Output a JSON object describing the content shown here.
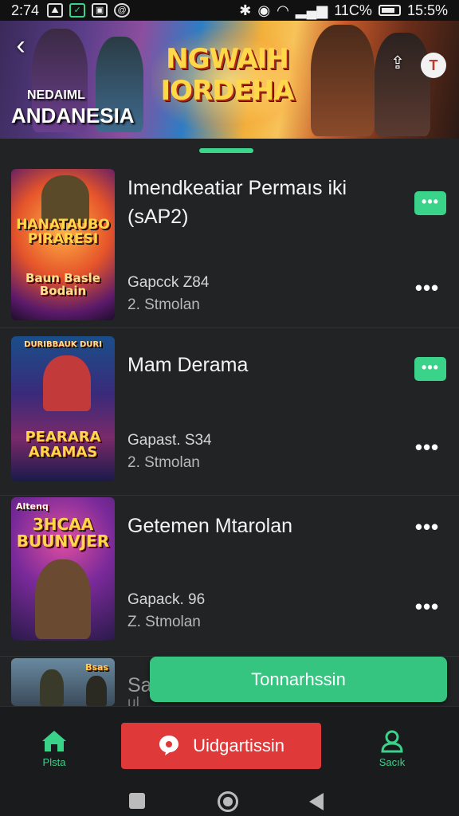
{
  "status_bar": {
    "time": "2:74",
    "battery": "11C%",
    "clock": "15:5%"
  },
  "banner": {
    "back_icon": "back-arrow-icon",
    "subtitle_line1": "NEDAIML",
    "subtitle_line2": "ANDANESIA",
    "title": "NGWAIH IORDEHA",
    "share_icon": "share-icon",
    "profile_letter": "T"
  },
  "items": [
    {
      "thumb_text": "HANATAUBO PIRARESI",
      "thumb_text2": "Baun Basle Bodain",
      "title": "Imendkeatiar Permaıs iki (sAP2)",
      "meta1": "Gapcck Z84",
      "meta2": "2. Stmolan",
      "has_tag": true,
      "tag_label": "•••",
      "more_label": "•••"
    },
    {
      "thumb_text": "PEARARA ARAMAS",
      "thumb_text2": "DURIBBAUK DURI",
      "title": "Mam Derama",
      "meta1": "Gapast. S34",
      "meta2": "2. Stmolan",
      "has_tag": true,
      "tag_label": "•••",
      "more_label": "•••"
    },
    {
      "thumb_text": "3HCAA BUUNVJER",
      "thumb_text2": "Altenq",
      "title": "Getemen Mtarolan",
      "meta1": "Gapack. 96",
      "meta2": "Z. Stmolan",
      "has_tag": false,
      "more_label": "•••",
      "more_label2": "•••"
    },
    {
      "thumb_text": "Bsas",
      "title": "Sa",
      "meta1": "ul",
      "has_tag": false
    }
  ],
  "float_button": {
    "label": "Tonnarhssin"
  },
  "bottom_nav": {
    "left_label": "Plsta",
    "center_label": "Uidgartissin",
    "right_label": "Sacık"
  },
  "colors": {
    "accent_green": "#3ad38a",
    "red": "#e0393a",
    "background": "#222324"
  }
}
